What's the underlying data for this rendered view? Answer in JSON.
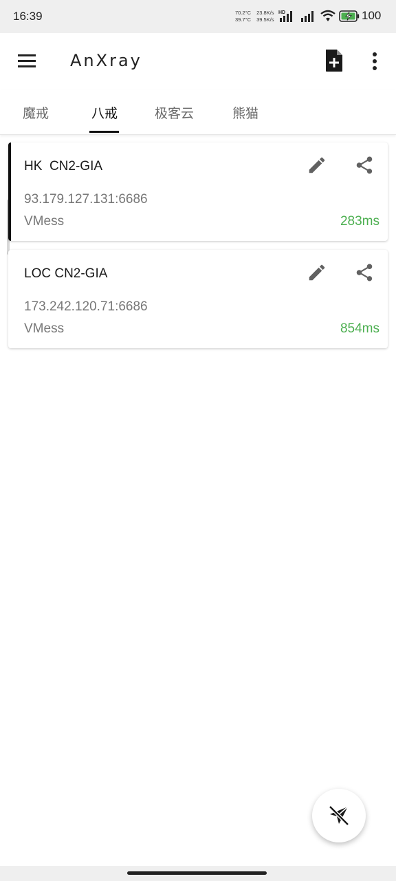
{
  "status_bar": {
    "time": "16:39",
    "cpu_temp": "70.2°C",
    "battery_temp": "39.7°C",
    "upload_speed": "23.8K/s",
    "download_speed": "39.5K/s",
    "battery_level": "100",
    "icons": [
      "hd-signal-icon",
      "signal-icon",
      "wifi-icon",
      "battery-charging-icon"
    ]
  },
  "app_bar": {
    "title": "AnXray",
    "icons": [
      "menu-icon",
      "add-file-icon",
      "more-vert-icon"
    ]
  },
  "tabs": [
    {
      "label": "魔戒",
      "active": false
    },
    {
      "label": "八戒",
      "active": true
    },
    {
      "label": "极客云",
      "active": false
    },
    {
      "label": "熊猫",
      "active": false
    }
  ],
  "servers": [
    {
      "name": "HK  CN2-GIA",
      "address": "93.179.127.131:6686",
      "protocol": "VMess",
      "latency": "283ms",
      "selected": true
    },
    {
      "name": "LOC CN2-GIA",
      "address": "173.242.120.71:6686",
      "protocol": "VMess",
      "latency": "854ms",
      "selected": false
    }
  ],
  "colors": {
    "latency_good": "#4caf50",
    "accent": "#111111",
    "status_bar_bg": "#efefef"
  },
  "fab": {
    "icon": "paper-plane-off-icon"
  }
}
